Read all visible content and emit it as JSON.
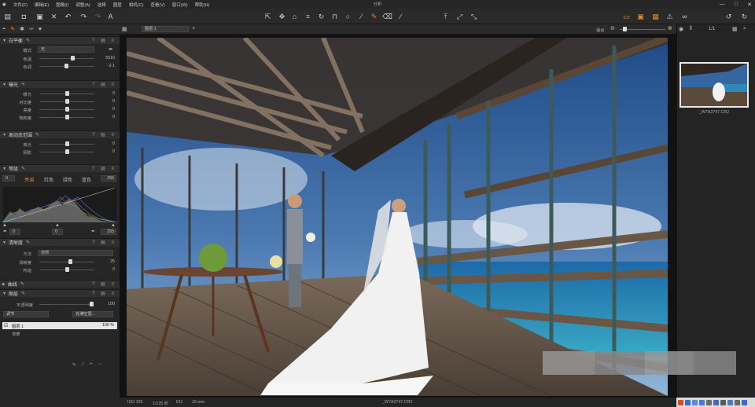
{
  "menu": [
    "文件(F)",
    "编辑(E)",
    "图像(I)",
    "调整(A)",
    "选择",
    "图层",
    "相机(C)",
    "查看(V)",
    "窗口(W)",
    "帮助(H)"
  ],
  "window_title": "分析",
  "left_tabs_icons": [
    "camera-icon",
    "brush-icon",
    "aperture-icon",
    "wrench-icon",
    "heart-icon"
  ],
  "sections": {
    "white_balance": {
      "title": "白平衡",
      "mode_label": "模式",
      "mode_value": "无",
      "rows": [
        {
          "label": "色温",
          "value": "5510",
          "pos": 0.6
        },
        {
          "label": "色调",
          "value": "-2.1",
          "pos": 0.48
        }
      ]
    },
    "exposure": {
      "title": "曝光",
      "rows": [
        {
          "label": "曝光",
          "value": "0",
          "pos": 0.5
        },
        {
          "label": "对比度",
          "value": "0",
          "pos": 0.5
        },
        {
          "label": "亮度",
          "value": "0",
          "pos": 0.5
        },
        {
          "label": "饱和度",
          "value": "0",
          "pos": 0.5
        }
      ]
    },
    "hdr": {
      "title": "高动态范围",
      "rows": [
        {
          "label": "高光",
          "value": "0",
          "pos": 0.5
        },
        {
          "label": "阴影",
          "value": "0",
          "pos": 0.5
        }
      ]
    },
    "levels": {
      "title": "等级",
      "left_value": "0",
      "right_value": "255",
      "tabs": [
        "亮调",
        "红色",
        "绿色",
        "蓝色"
      ],
      "bottom_left": "0",
      "bottom_mid": "0",
      "bottom_right": "255"
    },
    "clarity": {
      "title": "清晰度",
      "method_label": "方法",
      "method_value": "自然",
      "rows": [
        {
          "label": "清晰度",
          "value": "25",
          "pos": 0.55
        },
        {
          "label": "构造",
          "value": "0",
          "pos": 0.5
        }
      ]
    },
    "curve": {
      "title": "曲线"
    },
    "layers": {
      "title": "图层",
      "opacity_label": "不透明度",
      "opacity_value": "100",
      "adjust_label": "调节",
      "fill_label": "充满空层...",
      "layer_name": "图层 1",
      "layer_opacity": "100 %",
      "background": "背景"
    }
  },
  "viewer": {
    "layer_dropdown": "图层 1",
    "fit_label": "适合",
    "page": "1/1"
  },
  "status": {
    "iso": "ISO 100",
    "shutter": "1/125 秒",
    "aperture": "f/11",
    "focal": "16 mm",
    "filename": "_W7A3747.CR2"
  },
  "thumbnail": {
    "caption": "_W7A3747.CR2"
  },
  "colors": {
    "accent": "#e08a2c",
    "panel": "#262626",
    "slider": "#555555"
  }
}
